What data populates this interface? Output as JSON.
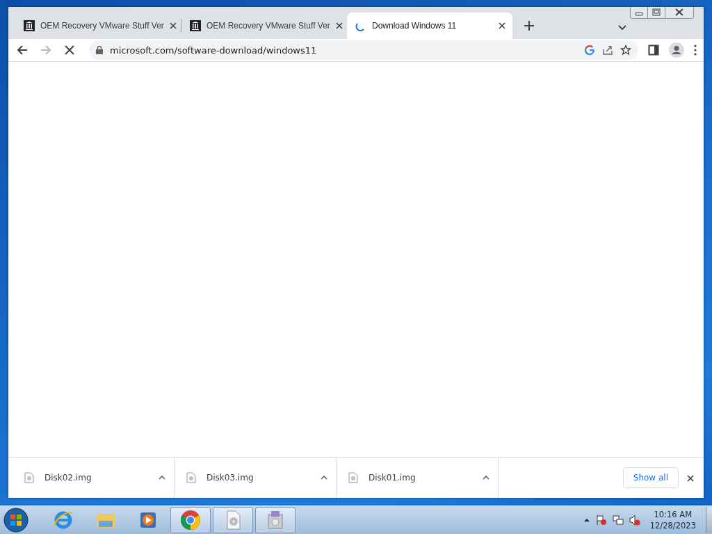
{
  "tabs": [
    {
      "title": "OEM Recovery VMware Stuff Ver",
      "selected": false,
      "loading": false
    },
    {
      "title": "OEM Recovery VMware Stuff Ver",
      "selected": false,
      "loading": false
    },
    {
      "title": "Download Windows 11",
      "selected": true,
      "loading": true
    }
  ],
  "address_bar": {
    "url": "microsoft.com/software-download/windows11"
  },
  "downloads": [
    {
      "filename": "Disk02.img"
    },
    {
      "filename": "Disk03.img"
    },
    {
      "filename": "Disk01.img"
    }
  ],
  "show_all": "Show all",
  "taskbar": {
    "items": [
      {
        "kind": "ie",
        "running": false
      },
      {
        "kind": "explorer",
        "running": false
      },
      {
        "kind": "media",
        "running": false
      },
      {
        "kind": "chrome",
        "running": true
      },
      {
        "kind": "disk",
        "running": true
      },
      {
        "kind": "installer",
        "running": true
      }
    ]
  },
  "clock": {
    "time": "10:16 AM",
    "date": "12/28/2023"
  }
}
